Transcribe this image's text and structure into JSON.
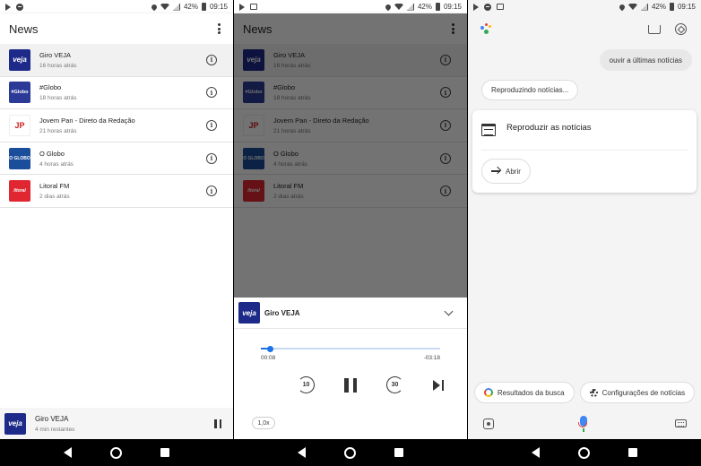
{
  "status_bar": {
    "battery": "42%",
    "time": "09:15"
  },
  "app": {
    "title": "News"
  },
  "feeds": [
    {
      "name": "Giro VEJA",
      "time": "16 horas atrás",
      "logo_text": "veja"
    },
    {
      "name": "#Globo",
      "time": "18 horas atrás",
      "logo_text": "#Globo"
    },
    {
      "name": "Jovem Pan - Direto da Redação",
      "time": "21 horas atrás",
      "logo_text": "JP"
    },
    {
      "name": "O Globo",
      "time": "4 horas atrás",
      "logo_text": "O GLOBO"
    },
    {
      "name": "Litoral FM",
      "time": "2 dias atrás",
      "logo_text": "litoral"
    }
  ],
  "mini_player": {
    "title": "Giro VEJA",
    "subtitle": "4 min restantes",
    "logo_text": "veja"
  },
  "player": {
    "title": "Giro VEJA",
    "logo_text": "veja",
    "elapsed": "00:08",
    "remaining": "-03:18",
    "progress": 0.05,
    "rewind_label": "10",
    "forward_label": "30",
    "speed": "1,0x"
  },
  "assistant": {
    "user_query": "ouvir a últimas notícias",
    "reply": "Reproduzindo notícias...",
    "card_title": "Reproduzir as notícias",
    "open_label": "Abrir",
    "chips": [
      "Resultados da busca",
      "Configurações de notícias"
    ]
  },
  "colors": {
    "accent": "#1a73e8",
    "veja": "#1d2a8a",
    "litoral": "#e02630"
  }
}
